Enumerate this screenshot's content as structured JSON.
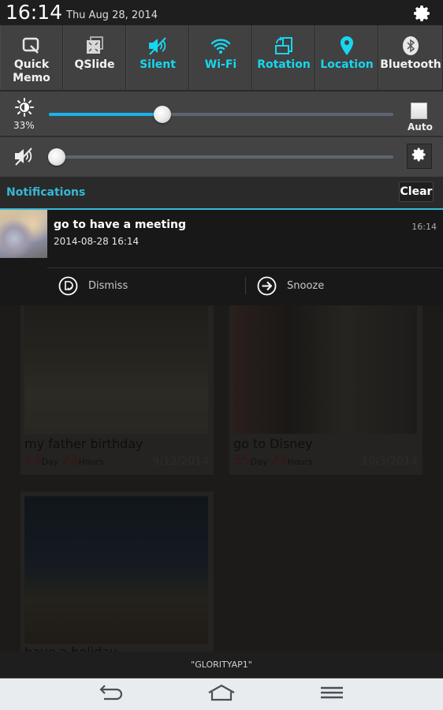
{
  "status_bar": {
    "time": "16:14",
    "date": "Thu Aug 28, 2014",
    "settings_icon": "gear-icon"
  },
  "quick_settings": {
    "active_color": "#17d6ef",
    "tiles": [
      {
        "label": "Quick\nMemo",
        "label_line1": "Quick",
        "label_line2": "Memo",
        "icon": "quick-memo-icon",
        "active": false
      },
      {
        "label": "QSlide",
        "icon": "qslide-icon",
        "active": false
      },
      {
        "label": "Silent",
        "icon": "silent-icon",
        "active": true
      },
      {
        "label": "Wi-Fi",
        "icon": "wifi-icon",
        "active": true
      },
      {
        "label": "Rotation",
        "icon": "rotation-icon",
        "active": true
      },
      {
        "label": "Location",
        "icon": "location-icon",
        "active": true
      },
      {
        "label": "Bluetooth",
        "icon": "bluetooth-icon",
        "active": false
      }
    ]
  },
  "brightness": {
    "icon": "brightness-icon",
    "percent_label": "33%",
    "value": 0.33,
    "auto_label": "Auto",
    "auto_checked": false
  },
  "volume": {
    "icon": "muted-speaker-icon",
    "value": 0.0,
    "settings_icon": "gear-icon"
  },
  "notifications": {
    "header": "Notifications",
    "clear_label": "Clear",
    "accent": "#36b8d8",
    "items": [
      {
        "title": "go to have a meeting",
        "subtitle": "2014-08-28 16:14",
        "time": "16:14",
        "actions": [
          {
            "label": "Dismiss",
            "icon": "dismiss-icon"
          },
          {
            "label": "Snooze",
            "icon": "arrow-right-circle-icon"
          }
        ]
      }
    ]
  },
  "background_app": {
    "cards": [
      {
        "title": "my father birthday",
        "days": "14",
        "day_unit": "Day",
        "hours": "23",
        "hour_unit": "Hours",
        "date": "9/12/2014"
      },
      {
        "title": "go to Disney",
        "days": "35",
        "day_unit": "Day",
        "hours": "23",
        "hour_unit": "Hours",
        "date": "10/3/2014"
      },
      {
        "title": "have a holiday"
      }
    ]
  },
  "wifi_ssid": "\"GLORITYAP1\"",
  "nav_bar": {
    "back_icon": "back-icon",
    "home_icon": "home-icon",
    "menu_icon": "menu-icon"
  }
}
